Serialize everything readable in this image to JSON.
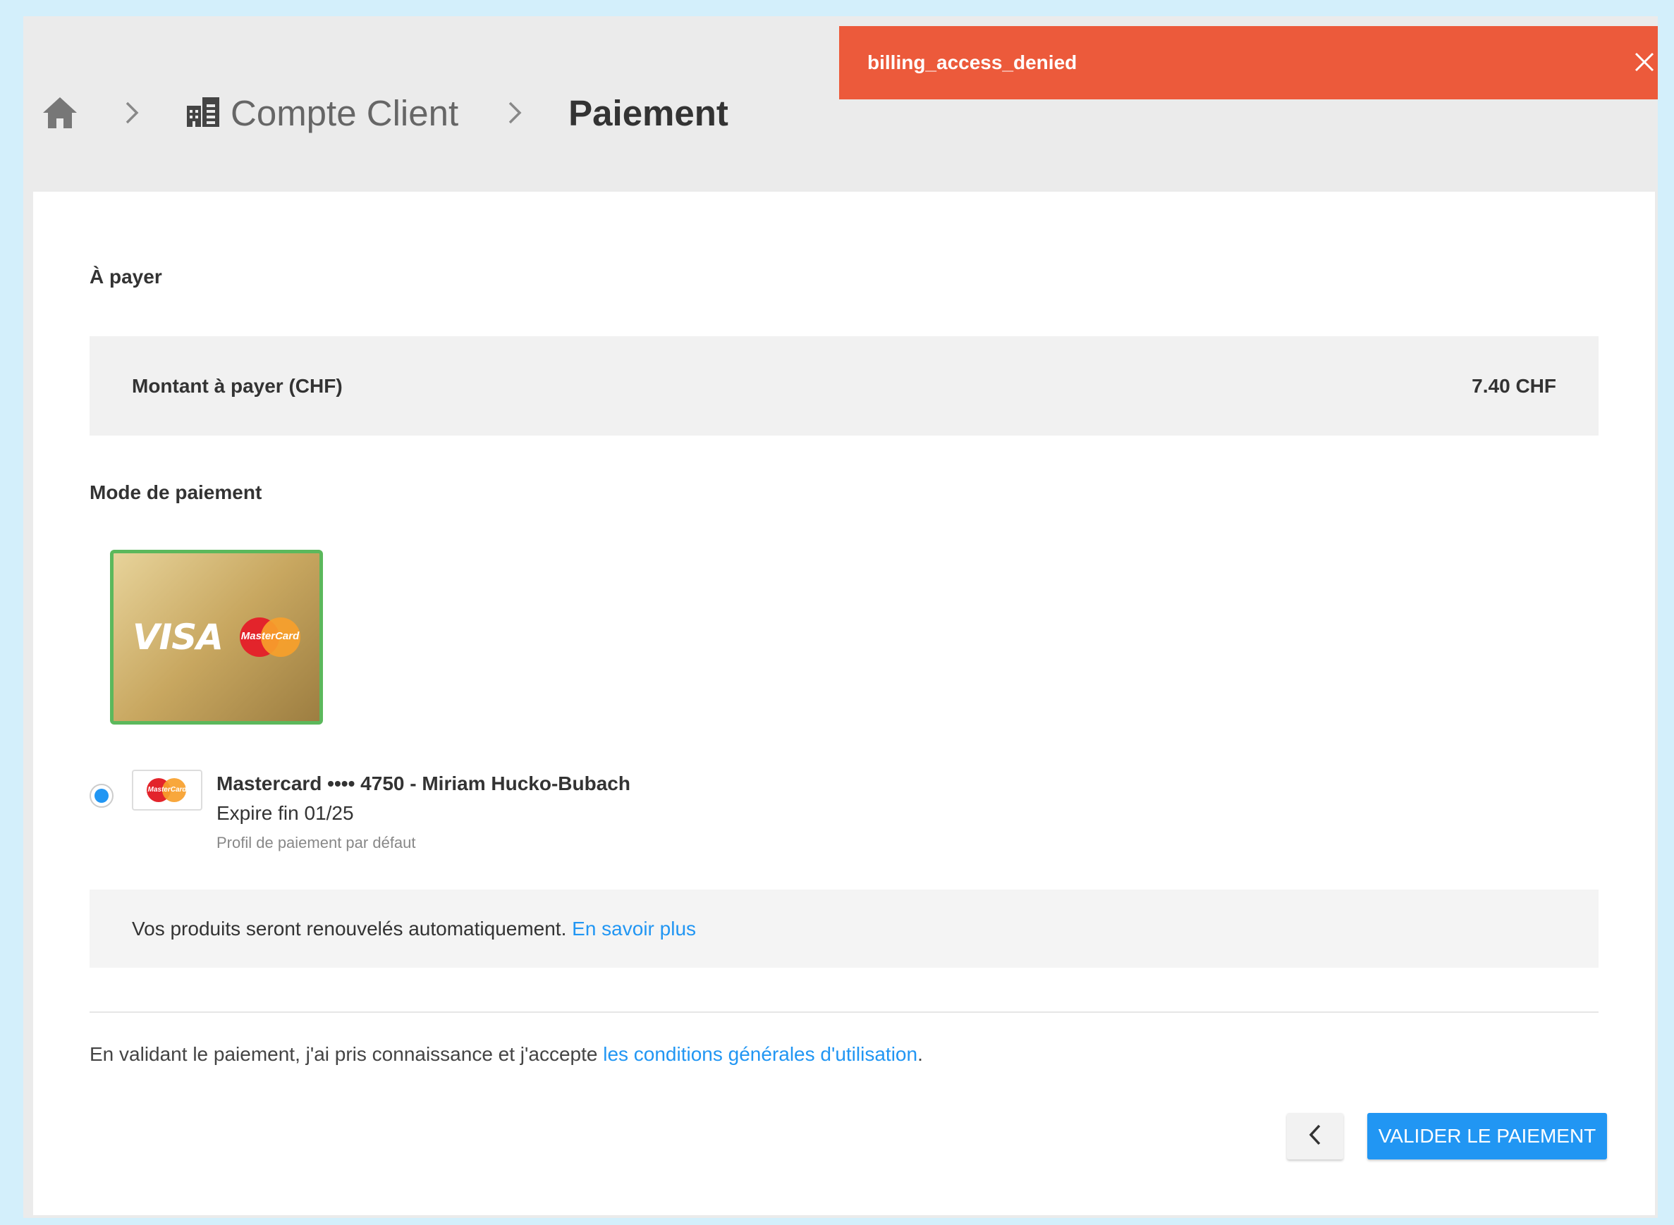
{
  "breadcrumb": {
    "account_label": "Compte Client",
    "current_label": "Paiement"
  },
  "toast": {
    "message": "billing_access_denied"
  },
  "payment": {
    "section_title": "À payer",
    "amount_label": "Montant à payer (CHF)",
    "amount_value": "7.40 CHF"
  },
  "method": {
    "section_title": "Mode de paiement",
    "card_brands": [
      "VISA",
      "MasterCard"
    ],
    "selected": {
      "title": "Mastercard •••• 4750 - Miriam Hucko-Bubach",
      "expiry": "Expire fin 01/25",
      "default_note": "Profil de paiement par défaut",
      "brand": "MasterCard"
    }
  },
  "renewal": {
    "text": "Vos produits seront renouvelés automatiquement.",
    "link": "En savoir plus"
  },
  "terms": {
    "prefix": "En validant le paiement, j'ai pris connaissance et j'accepte ",
    "link": "les conditions générales d'utilisation",
    "suffix": "."
  },
  "actions": {
    "validate_label": "VALIDER LE PAIEMENT"
  },
  "colors": {
    "accent": "#2196f3",
    "error": "#ec5a3b",
    "selected_border": "#5cb85c"
  }
}
